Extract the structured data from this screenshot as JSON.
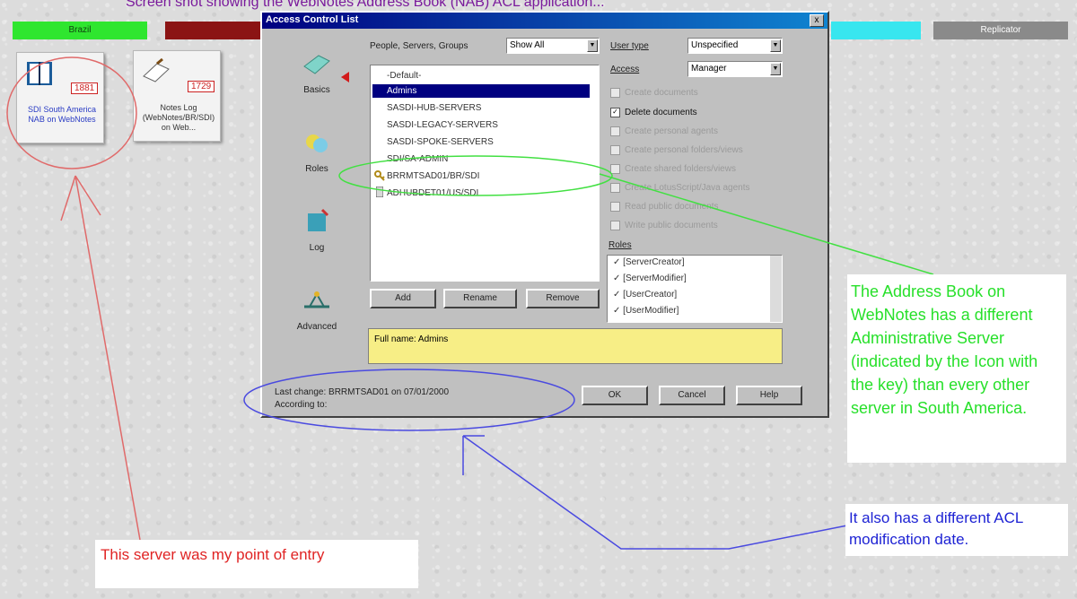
{
  "top_caption": "Screen shot showing the WebNotes Address Book (NAB) ACL application...",
  "db_tabs": [
    "Brazil",
    "",
    "",
    "Replicator"
  ],
  "tiles": [
    {
      "count": "1881",
      "label": "SDI South America NAB on WebNotes"
    },
    {
      "count": "1729",
      "label": "Notes Log (WebNotes/BR/SDI) on Web..."
    }
  ],
  "dialog": {
    "title": "Access Control List",
    "close": "x",
    "nav": [
      "Basics",
      "Roles",
      "Log",
      "Advanced"
    ],
    "people_label": "People, Servers, Groups",
    "show_filter": "Show All",
    "user_type_label": "User type",
    "user_type_value": "Unspecified",
    "access_label": "Access",
    "access_value": "Manager",
    "entries": [
      "-Default-",
      "Admins",
      "SASDI-HUB-SERVERS",
      "SASDI-LEGACY-SERVERS",
      "SASDI-SPOKE-SERVERS",
      "SDI/SA-ADMIN",
      "BRRMTSAD01/BR/SDI",
      "ADHUBDET01/US/SDI"
    ],
    "checkboxes": [
      {
        "label": "Create documents",
        "checked": false
      },
      {
        "label": "Delete documents",
        "checked": true
      },
      {
        "label": "Create personal agents",
        "checked": false
      },
      {
        "label": "Create personal folders/views",
        "checked": false
      },
      {
        "label": "Create shared folders/views",
        "checked": false
      },
      {
        "label": "Create LotusScript/Java agents",
        "checked": false
      },
      {
        "label": "Read public documents",
        "checked": false
      },
      {
        "label": "Write public documents",
        "checked": false
      }
    ],
    "roles_label": "Roles",
    "roles": [
      "[ServerCreator]",
      "[ServerModifier]",
      "[UserCreator]",
      "[UserModifier]"
    ],
    "buttons": {
      "add": "Add",
      "rename": "Rename",
      "remove": "Remove",
      "ok": "OK",
      "cancel": "Cancel",
      "help": "Help"
    },
    "full_name": "Full name: Admins",
    "last_change": "Last change: BRRMTSAD01 on 07/01/2000",
    "according_to": "According to:"
  },
  "annotations": {
    "green": "The Address Book on WebNotes has a different Administrative Server (indicated by the Icon with the key) than every other server in South America.",
    "blue": "It also has a different ACL modification date.",
    "red": "This server was my point of entry"
  },
  "colors": {
    "green": "#27e02a",
    "blue": "#1e23d4",
    "red": "#e02424",
    "titlebar": "#000080",
    "yellow": "#f7ee86"
  }
}
